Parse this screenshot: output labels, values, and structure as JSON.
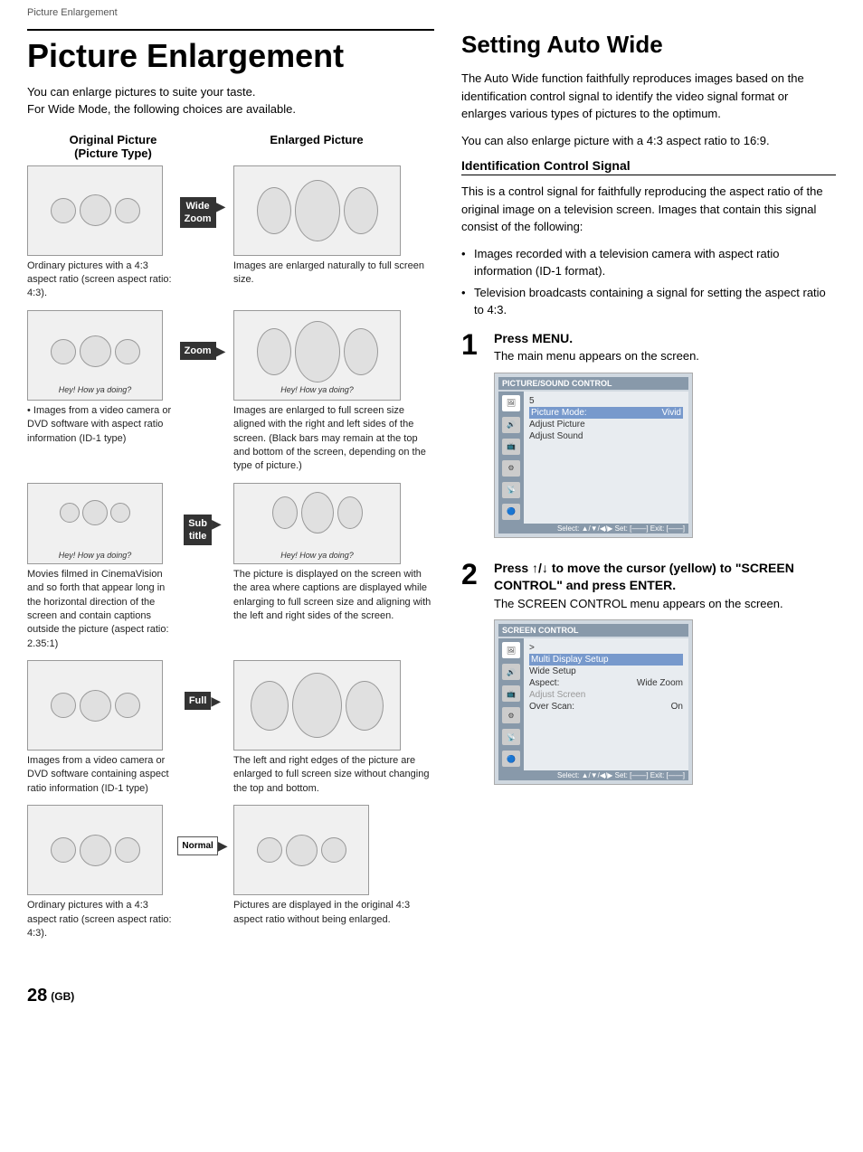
{
  "page": {
    "breadcrumb": "Picture Enlargement",
    "page_number": "28",
    "page_suffix": "(GB)"
  },
  "left": {
    "title": "Picture Enlargement",
    "intro_line1": "You can enlarge pictures to suite your taste.",
    "intro_line2": "For Wide Mode, the following choices are available.",
    "col_original": "Original Picture\n(Picture Type)",
    "col_original_line1": "Original Picture",
    "col_original_line2": "(Picture Type)",
    "col_enlarged": "Enlarged Picture",
    "rows": [
      {
        "id": "wide-zoom",
        "badge": "Wide\nZoom",
        "badge_style": "dark",
        "original_caption": "Ordinary pictures with a 4:3 aspect ratio (screen aspect ratio: 4:3).",
        "enlarged_caption": "Images are enlarged naturally to full screen size."
      },
      {
        "id": "zoom",
        "badge": "Zoom",
        "badge_style": "dark",
        "original_caption": "• Images from a video camera or DVD software with aspect ratio information (ID-1 type)",
        "enlarged_caption": "Images are enlarged to full screen size aligned with the right and left sides of the screen. (Black bars may remain at the top and bottom of the screen, depending on the type of picture.)"
      },
      {
        "id": "subtitle",
        "badge": "Sub\ntitle",
        "badge_style": "dark",
        "original_caption": "Movies filmed in CinemaVision and so forth that appear long in the horizontal direction of the screen and contain captions outside the picture (aspect ratio: 2.35:1)",
        "enlarged_caption": "The picture is displayed on the screen with the area where captions are displayed while enlarging to full screen size and aligning with the left and right sides of the screen."
      },
      {
        "id": "full",
        "badge": "Full",
        "badge_style": "dark_arrow",
        "original_caption": "Images from a video camera or DVD software containing aspect ratio information (ID-1 type)",
        "enlarged_caption": "The left and right edges of the picture are enlarged to full screen size without changing the top and bottom."
      },
      {
        "id": "normal",
        "badge": "Normal",
        "badge_style": "white_arrow",
        "original_caption": "Ordinary pictures with a 4:3 aspect ratio (screen aspect ratio: 4:3).",
        "enlarged_caption": "Pictures are displayed in the original 4:3 aspect ratio without being enlarged."
      }
    ]
  },
  "right": {
    "title": "Setting Auto Wide",
    "intro_p1": "The Auto Wide function faithfully reproduces images based on the identification control signal to identify the video signal format or enlarges various types of pictures to the optimum.",
    "intro_p2": "You can also enlarge picture with a 4:3 aspect ratio to 16:9.",
    "subsection_title": "Identification Control Signal",
    "subsection_intro": "This is a control signal for faithfully reproducing the aspect ratio of the original image on a television screen. Images that contain this signal consist of the following:",
    "bullets": [
      "Images recorded with a television camera with aspect ratio information (ID-1 format).",
      "Television broadcasts containing a signal for setting the aspect ratio to 4:3."
    ],
    "steps": [
      {
        "number": "1",
        "title": "Press MENU.",
        "desc": "The main menu appears on the screen.",
        "menu": {
          "title": "PICTURE/SOUND CONTROL",
          "icon_count": 6,
          "rows": [
            {
              "label": "5",
              "value": "",
              "style": "normal"
            },
            {
              "label": "Picture Mode:",
              "value": "Vivid",
              "style": "highlighted"
            },
            {
              "label": "Adjust Picture",
              "value": "",
              "style": "normal"
            },
            {
              "label": "Adjust Sound",
              "value": "",
              "style": "normal"
            }
          ],
          "footer": "Select: ▲/▼/◀/▶   Set: [——]   Exit: [——]"
        }
      },
      {
        "number": "2",
        "title": "Press ↑/↓ to move the cursor (yellow) to \"SCREEN CONTROL\" and press ENTER.",
        "desc": "The SCREEN CONTROL menu appears on the screen.",
        "menu": {
          "title": "SCREEN CONTROL",
          "icon_count": 6,
          "rows": [
            {
              "label": ">",
              "value": "",
              "style": "normal"
            },
            {
              "label": "Multi Display Setup",
              "value": "",
              "style": "highlighted"
            },
            {
              "label": "Wide Setup",
              "value": "",
              "style": "normal"
            },
            {
              "label": "Aspect:",
              "value": "Wide Zoom",
              "style": "normal"
            },
            {
              "label": "Adjust Screen",
              "value": "",
              "style": "dimmed"
            },
            {
              "label": "Over Scan:",
              "value": "On",
              "style": "normal"
            }
          ],
          "footer": "Select: ▲/▼/◀/▶   Set: [——]   Exit: [——]"
        }
      }
    ]
  }
}
